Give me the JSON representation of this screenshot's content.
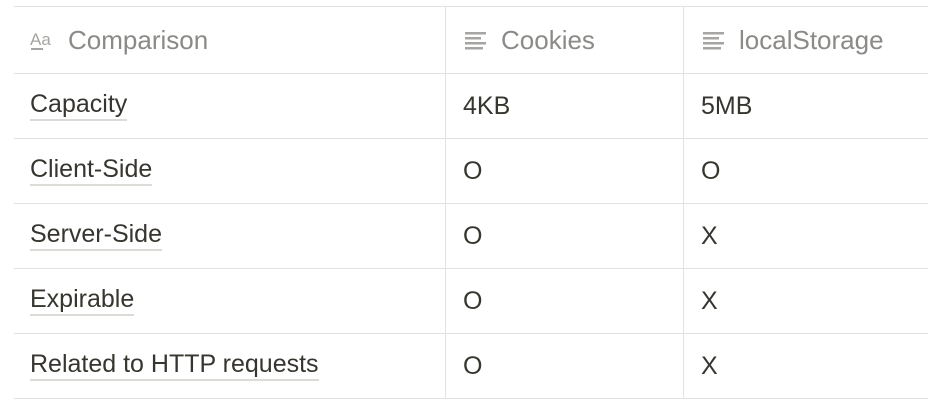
{
  "table": {
    "headers": [
      {
        "label": "Comparison",
        "icon": "text-title-icon"
      },
      {
        "label": "Cookies",
        "icon": "text-lines-icon"
      },
      {
        "label": "localStorage",
        "icon": "text-lines-icon"
      }
    ],
    "rows": [
      {
        "comparison": "Capacity",
        "cookies": "4KB",
        "localstorage": "5MB"
      },
      {
        "comparison": "Client-Side",
        "cookies": "O",
        "localstorage": "O"
      },
      {
        "comparison": "Server-Side",
        "cookies": "O",
        "localstorage": "X"
      },
      {
        "comparison": "Expirable",
        "cookies": "O",
        "localstorage": "X"
      },
      {
        "comparison": "Related to HTTP requests",
        "cookies": "O",
        "localstorage": "X"
      }
    ]
  }
}
